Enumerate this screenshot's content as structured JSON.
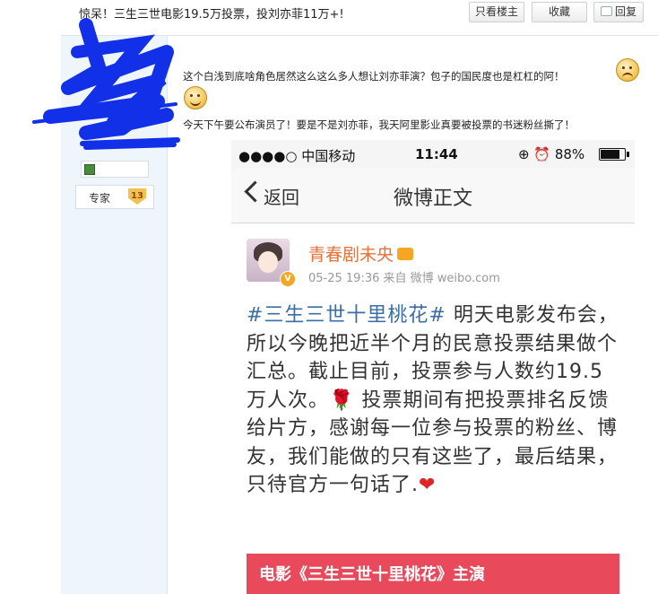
{
  "header": {
    "title": "惊呆！三生三世电影19.5万投票，投刘亦菲11万+!",
    "buttons": {
      "only_author": "只看楼主",
      "favorite": "收藏",
      "reply": "回复"
    }
  },
  "sidebar": {
    "expert_label": "专家",
    "expert_level": "13"
  },
  "post": {
    "line1": "这个白浅到底啥角色居然这么这么多人想让刘亦菲演？包子的国民度也是杠杠的阿！",
    "line2": "今天下午要公布演员了！要是不是刘亦菲，我天阿里影业真要被投票的书迷粉丝撕了！"
  },
  "phone": {
    "status": {
      "carrier": "●●●●○ 中国移动",
      "time": "11:44",
      "battery_text": "88%",
      "battery_level": 0.88
    },
    "nav": {
      "back": "返回",
      "title": "微博正文"
    },
    "weibo": {
      "author": "青春剧未央",
      "meta": "05-25 19:36  来自 微博 weibo.com",
      "hashtag": "#三生三世十里桃花#",
      "text_part1": " 明天电影发布会，所以今晚把近半个月的民意投票结果做个汇总。截止目前，投票参与人数约19.5万人次。",
      "text_part2": " 投票期间有把投票排名反馈给片方，感谢每一位参与投票的粉丝、博友，我们能做的只有这些了，最后结果，只待官方一句话了.",
      "banner": "电影《三生三世十里桃花》主演"
    }
  }
}
